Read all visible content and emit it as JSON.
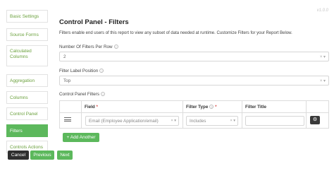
{
  "version": "v1.0.0",
  "sidebar": {
    "items": [
      {
        "label": "Basic Settings"
      },
      {
        "label": "Source Forms"
      },
      {
        "label": "Calculated Columns"
      },
      {
        "label": "Aggregation"
      },
      {
        "label": "Columns"
      },
      {
        "label": "Control Panel"
      },
      {
        "label": "Filters",
        "active": true
      },
      {
        "label": "Controls Actions"
      }
    ]
  },
  "main": {
    "title": "Control Panel - Filters",
    "description": "Filters enable end users of this report to view any subset of data needed at runtime. Customize Filters for your Report Below.",
    "filters_per_row": {
      "label": "Number Of Filters Per Row",
      "value": "2"
    },
    "label_position": {
      "label": "Filter Label Position",
      "value": "Top"
    },
    "control_panel_filters_label": "Control Panel Filters",
    "table": {
      "headers": {
        "field": "Field",
        "filter_type": "Filter Type",
        "filter_title": "Filter Title",
        "required_mark": "*"
      },
      "row": {
        "field": "Email (Employee Application/email)",
        "filter_type": "Includes",
        "filter_title": ""
      }
    },
    "add_another_label": "+ Add Another"
  },
  "footer": {
    "cancel": "Cancel",
    "previous": "Previous",
    "next": "Next"
  },
  "colors": {
    "accent": "#5cb85c",
    "link": "#6aa03c",
    "dark": "#2f2f2f",
    "required": "#d9534f"
  }
}
